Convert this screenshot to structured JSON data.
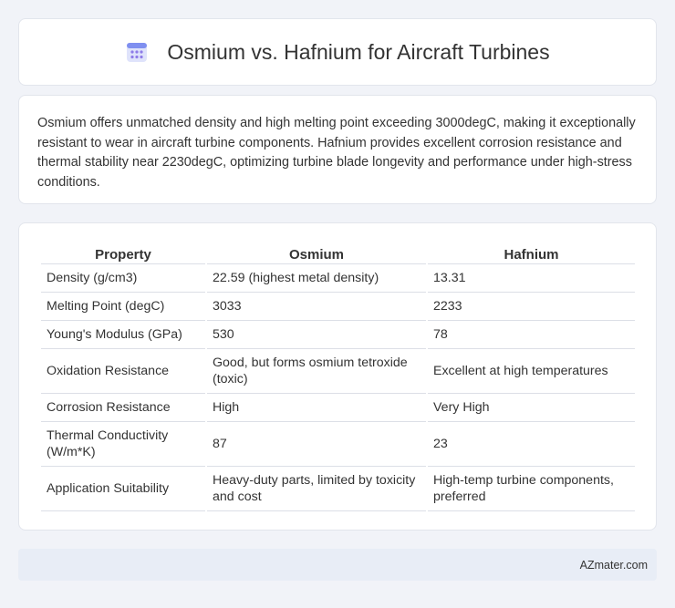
{
  "header": {
    "title": "Osmium vs. Hafnium for Aircraft Turbines",
    "icon": "calendar-grid-icon"
  },
  "description": "Osmium offers unmatched density and high melting point exceeding 3000degC, making it exceptionally resistant to wear in aircraft turbine components. Hafnium provides excellent corrosion resistance and thermal stability near 2230degC, optimizing turbine blade longevity and performance under high-stress conditions.",
  "table": {
    "headers": [
      "Property",
      "Osmium",
      "Hafnium"
    ],
    "rows": [
      [
        "Density (g/cm3)",
        "22.59 (highest metal density)",
        "13.31"
      ],
      [
        "Melting Point (degC)",
        "3033",
        "2233"
      ],
      [
        "Young's Modulus (GPa)",
        "530",
        "78"
      ],
      [
        "Oxidation Resistance",
        "Good, but forms osmium tetroxide (toxic)",
        "Excellent at high temperatures"
      ],
      [
        "Corrosion Resistance",
        "High",
        "Very High"
      ],
      [
        "Thermal Conductivity (W/m*K)",
        "87",
        "23"
      ],
      [
        "Application Suitability",
        "Heavy-duty parts, limited by toxicity and cost",
        "High-temp turbine components, preferred"
      ]
    ]
  },
  "footer": {
    "brand": "AZmater.com"
  }
}
